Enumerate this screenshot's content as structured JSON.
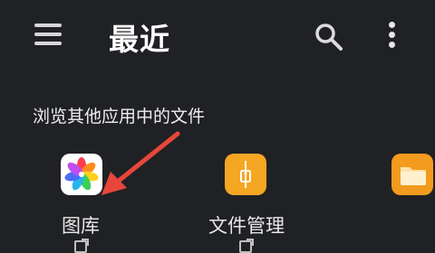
{
  "header": {
    "title": "最近",
    "menu_icon": "hamburger-menu-icon",
    "search_icon": "search-icon",
    "more_icon": "more-vertical-icon"
  },
  "section": {
    "label": "浏览其他应用中的文件"
  },
  "apps": [
    {
      "label": "图库",
      "icon": "gallery-pinwheel-icon"
    },
    {
      "label": "文件管理",
      "icon": "file-manager-folder-icon"
    },
    {
      "label": "",
      "icon": "folder-app-icon"
    }
  ],
  "annotation": {
    "color": "#e8463b"
  },
  "colors": {
    "background": "#202124",
    "file_manager_orange": "#f5a623",
    "folder_orange": "#f29b1e"
  }
}
